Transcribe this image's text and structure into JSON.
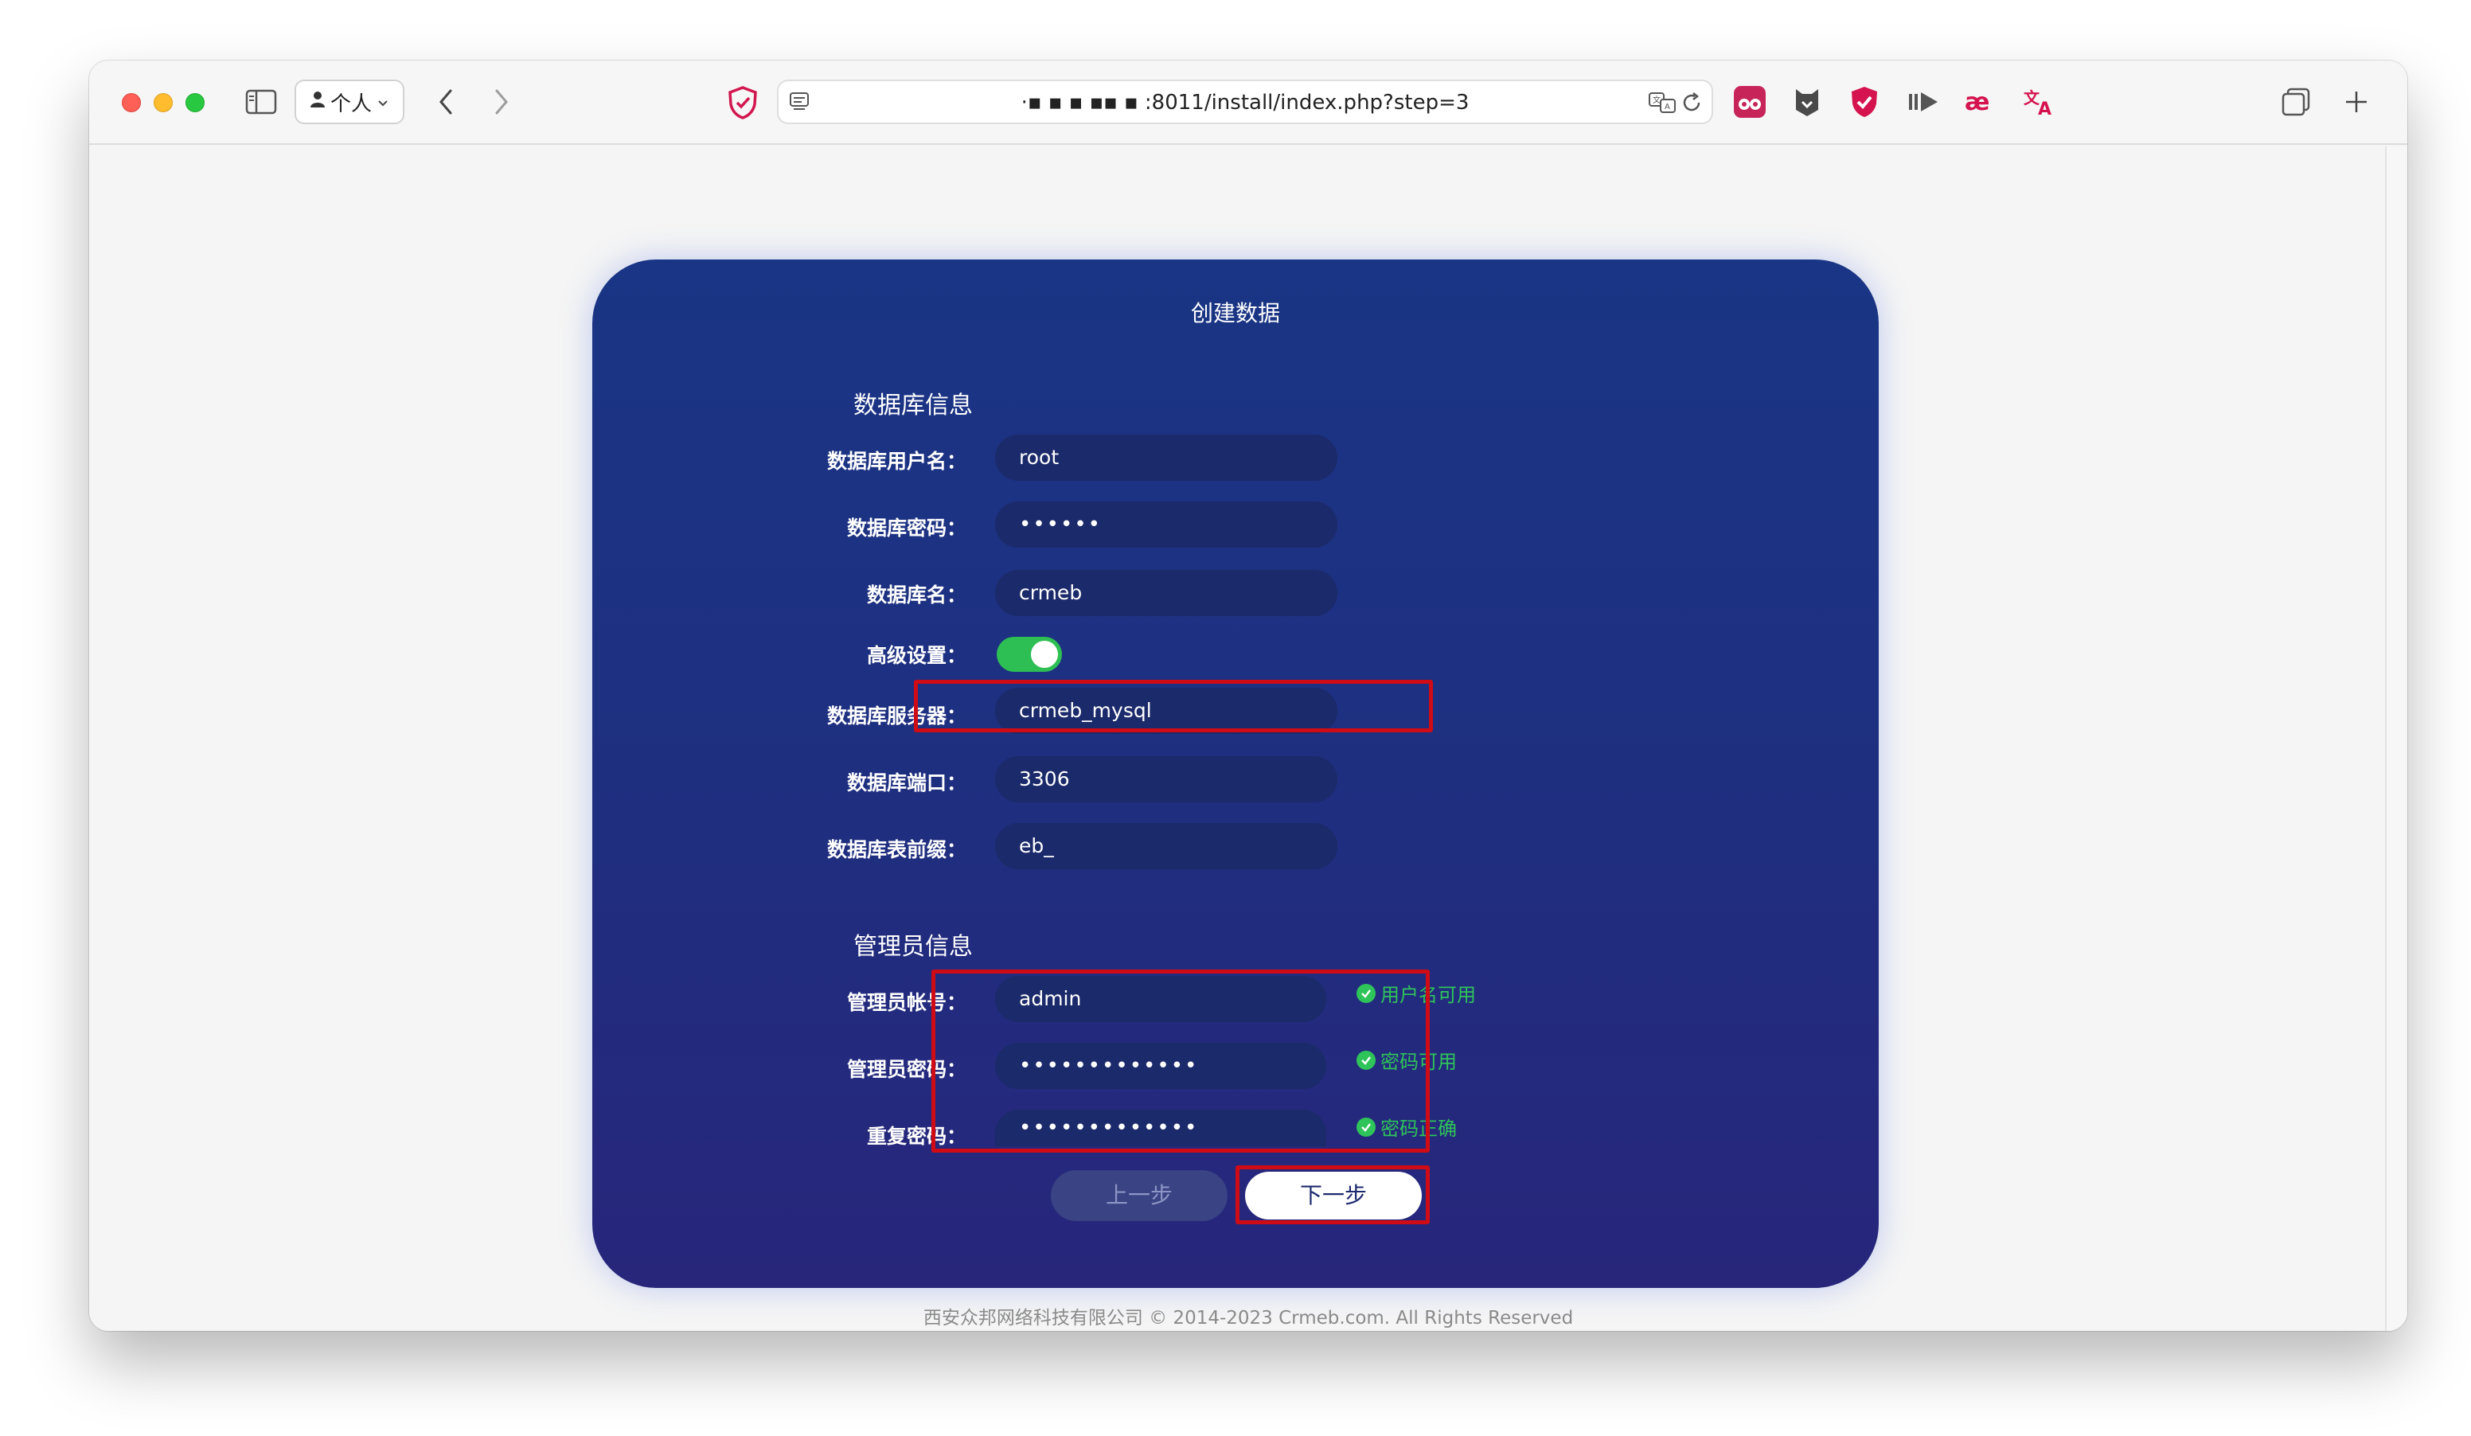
{
  "browser": {
    "profile_label": "个人",
    "url": "·▪ ▪ ▪ ▪▪ ▪ :8011/install/index.php?step=3"
  },
  "card": {
    "title": "创建数据"
  },
  "db_section": {
    "title": "数据库信息",
    "fields": [
      {
        "label": "数据库用户名：",
        "value": "root"
      },
      {
        "label": "数据库密码：",
        "value": "••••••"
      },
      {
        "label": "数据库名：",
        "value": "crmeb"
      },
      {
        "label": "高级设置：",
        "value": ""
      },
      {
        "label": "数据库服务器：",
        "value": "crmeb_mysql"
      },
      {
        "label": "数据库端口：",
        "value": "3306"
      },
      {
        "label": "数据库表前缀：",
        "value": "eb_"
      }
    ],
    "advanced_toggle_on": true
  },
  "admin_section": {
    "title": "管理员信息",
    "fields": [
      {
        "label": "管理员帐号：",
        "value": "admin",
        "status": "用户名可用"
      },
      {
        "label": "管理员密码：",
        "value": "•••••••••••••",
        "status": "密码可用"
      },
      {
        "label": "重复密码：",
        "value": "•••••••••••••",
        "status": "密码正确"
      }
    ]
  },
  "buttons": {
    "prev": "上一步",
    "next": "下一步"
  },
  "footer": "西安众邦网络科技有限公司 © 2014-2023 Crmeb.com. All Rights Reserved",
  "colors": {
    "card_top": "#1a3585",
    "card_bottom": "#27267b",
    "success": "#2fc45a",
    "highlight": "#cf0c15"
  }
}
